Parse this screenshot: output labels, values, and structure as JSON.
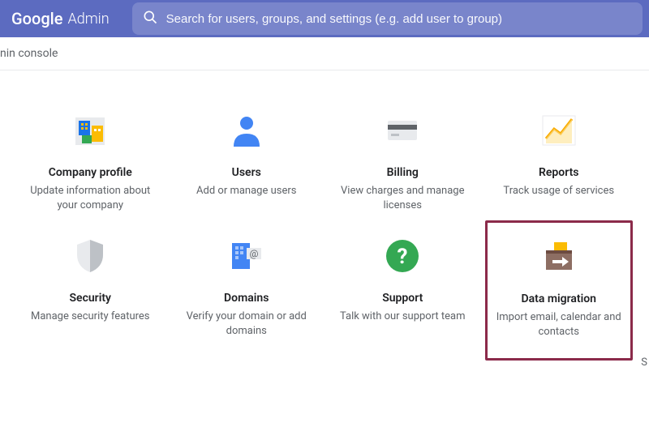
{
  "header": {
    "logo_google": "Google",
    "logo_admin": "Admin",
    "search_placeholder": "Search for users, groups, and settings (e.g. add user to group)"
  },
  "breadcrumb": "nin console",
  "tiles": [
    {
      "title": "Company profile",
      "desc": "Update information about your company"
    },
    {
      "title": "Users",
      "desc": "Add or manage users"
    },
    {
      "title": "Billing",
      "desc": "View charges and manage licenses"
    },
    {
      "title": "Reports",
      "desc": "Track usage of services"
    },
    {
      "title": "Security",
      "desc": "Manage security features"
    },
    {
      "title": "Domains",
      "desc": "Verify your domain or add domains"
    },
    {
      "title": "Support",
      "desc": "Talk with our support team"
    },
    {
      "title": "Data migration",
      "desc": "Import email, calendar and contacts"
    }
  ],
  "edge_letter": "S"
}
